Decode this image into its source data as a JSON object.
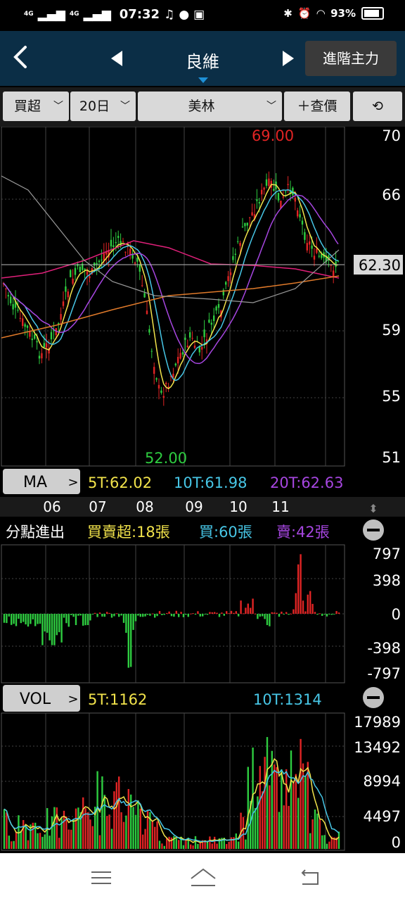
{
  "status_bar": {
    "signal1": "4G",
    "signal2": "4G",
    "time": "07:32",
    "battery": "93%"
  },
  "nav": {
    "title": "良維",
    "advanced_button": "進階主力"
  },
  "filters": {
    "type": "買超",
    "period": "20日",
    "broker": "美林",
    "lookup": "＋查價"
  },
  "price_panel": {
    "high_label": "69.00",
    "low_label": "52.00",
    "current_price": "62.30",
    "y_ticks": [
      "70",
      "66",
      "59",
      "55",
      "51"
    ]
  },
  "ma_bar": {
    "label": "MA",
    "ma5": "5T:62.02",
    "ma10": "10T:61.98",
    "ma20": "20T:62.63"
  },
  "months": [
    "06",
    "07",
    "08",
    "09",
    "10",
    "11"
  ],
  "broker_panel": {
    "title": "分點進出",
    "net": "買賣超:18張",
    "buy": "買:60張",
    "sell": "賣:42張",
    "y_ticks": [
      "797",
      "398",
      "0",
      "-398",
      "-797"
    ]
  },
  "vol_bar": {
    "label": "VOL",
    "ma5": "5T:1162",
    "ma10": "10T:1314",
    "y_ticks": [
      "17989",
      "13492",
      "8994",
      "4497",
      "0"
    ]
  },
  "colors": {
    "up": "#e02424",
    "down": "#2ecc40",
    "ma5": "#f2e34b",
    "ma10": "#47c6e6",
    "ma20": "#a646e0",
    "nav_bg": "#0b2e46"
  }
}
